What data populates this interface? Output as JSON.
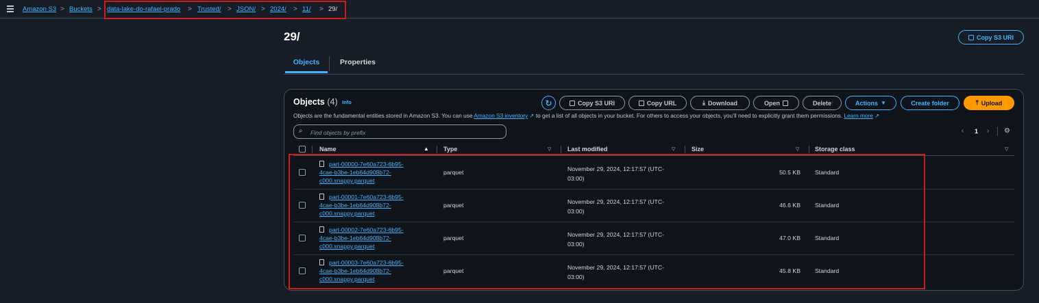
{
  "breadcrumb": {
    "items": [
      "Amazon S3",
      "Buckets",
      "data-lake-do-rafael-prado",
      "Trusted/",
      "JSON/",
      "2024/",
      "11/",
      "29/"
    ]
  },
  "page": {
    "title": "29/",
    "copy_uri_label": "Copy S3 URI"
  },
  "tabs": {
    "objects": "Objects",
    "properties": "Properties"
  },
  "objects_panel": {
    "heading": "Objects",
    "count": "(4)",
    "info": "Info",
    "toolbar": {
      "copy_s3_uri": "Copy S3 URI",
      "copy_url": "Copy URL",
      "download": "Download",
      "open": "Open",
      "delete": "Delete",
      "actions": "Actions",
      "create_folder": "Create folder",
      "upload": "Upload"
    },
    "desc_pre": "Objects are the fundamental entities stored in Amazon S3. You can use ",
    "desc_link": "Amazon S3 inventory",
    "desc_post": " to get a list of all objects in your bucket. For others to access your objects, you’ll need to explicitly grant them permissions. ",
    "learn_more": "Learn more",
    "search_placeholder": "Find objects by prefix",
    "page_number": "1",
    "columns": {
      "name": "Name",
      "type": "Type",
      "last_modified": "Last modified",
      "size": "Size",
      "storage_class": "Storage class"
    },
    "rows": [
      {
        "name_1": "part-00000-7e60a723-6b95-",
        "name_2": "4cae-b3be-1eb64d908b72-",
        "name_3": "c000.snappy.parquet",
        "type": "parquet",
        "modified_1": "November 29, 2024, 12:17:57 (UTC-",
        "modified_2": "03:00)",
        "size": "50.5 KB",
        "storage": "Standard"
      },
      {
        "name_1": "part-00001-7e60a723-6b95-",
        "name_2": "4cae-b3be-1eb64d908b72-",
        "name_3": "c000.snappy.parquet",
        "type": "parquet",
        "modified_1": "November 29, 2024, 12:17:57 (UTC-",
        "modified_2": "03:00)",
        "size": "46.6 KB",
        "storage": "Standard"
      },
      {
        "name_1": "part-00002-7e60a723-6b95-",
        "name_2": "4cae-b3be-1eb64d908b72-",
        "name_3": "c000.snappy.parquet",
        "type": "parquet",
        "modified_1": "November 29, 2024, 12:17:57 (UTC-",
        "modified_2": "03:00)",
        "size": "47.0 KB",
        "storage": "Standard"
      },
      {
        "name_1": "part-00003-7e60a723-6b95-",
        "name_2": "4cae-b3be-1eb64d908b72-",
        "name_3": "c000.snappy.parquet",
        "type": "parquet",
        "modified_1": "November 29, 2024, 12:17:57 (UTC-",
        "modified_2": "03:00)",
        "size": "45.8 KB",
        "storage": "Standard"
      }
    ]
  },
  "colors": {
    "background": "#161d26",
    "link": "#42b4ff",
    "primary": "#ff9900",
    "highlight": "#d51818"
  }
}
